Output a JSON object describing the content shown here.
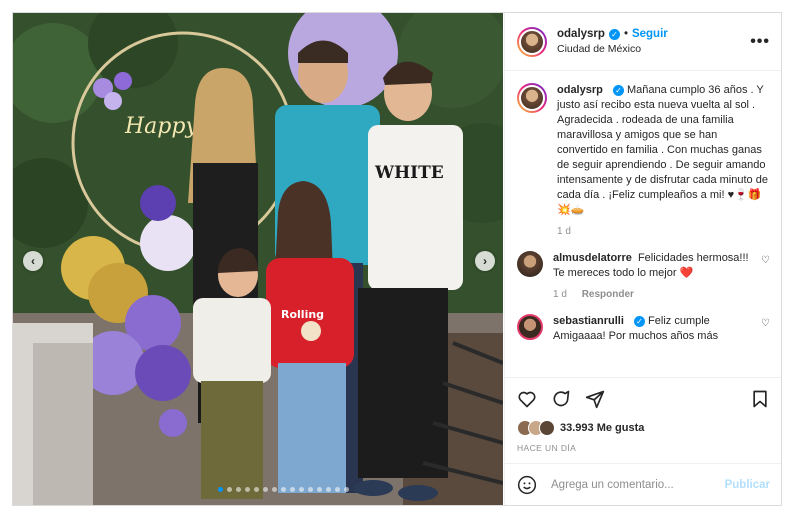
{
  "post": {
    "username": "odalysrp",
    "follow_label": "Seguir",
    "separator": "•",
    "location": "Ciudad de México",
    "more_label": "•••",
    "photo_text": "WHITE",
    "photo_sign": "Happy",
    "shirt_text": "Rolling Stones"
  },
  "caption": {
    "username": "odalysrp",
    "text": "Mañana cumplo 36 años . Y justo así recibo esta nueva vuelta al sol . Agradecida . rodeada de una familia maravillosa y amigos que se han convertido en familia . Con muchas ganas de seguir aprendiendo . De seguir amando intensamente y de disfrutar cada minuto de cada día . ¡Feliz cumpleaños a mi! ♥🍷🎁💥🥧",
    "time": "1 d"
  },
  "comments": [
    {
      "username": "almusdelatorre",
      "text": "Felicidades hermosa!!! Te mereces todo lo mejor ❤️",
      "time": "1 d",
      "reply_label": "Responder"
    },
    {
      "username": "sebastianrulli",
      "text": "Feliz cumple Amigaaaa! Por muchos años más",
      "time": "",
      "reply_label": ""
    }
  ],
  "actions": {
    "likes_count": "33.993",
    "likes_label": "Me gusta",
    "posted": "HACE UN DÍA"
  },
  "composer": {
    "placeholder": "Agrega un comentario...",
    "publish_label": "Publicar"
  },
  "carousel": {
    "slides": 15,
    "active_index": 0
  },
  "colors": {
    "accent": "#0095f6",
    "text": "#262626",
    "muted": "#8e8e8e",
    "publish_disabled": "#b2dffc"
  }
}
